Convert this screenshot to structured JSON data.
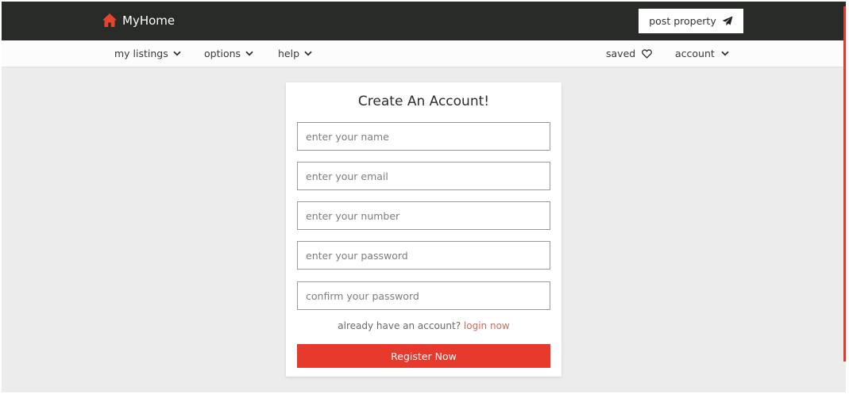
{
  "header": {
    "brand": "MyHome",
    "post_property_label": "post property"
  },
  "nav": {
    "left": [
      {
        "label": "my listings"
      },
      {
        "label": "options"
      },
      {
        "label": "help"
      }
    ],
    "saved_label": "saved",
    "account_label": "account"
  },
  "form": {
    "title": "Create An Account!",
    "name_placeholder": "enter your name",
    "email_placeholder": "enter your email",
    "number_placeholder": "enter your number",
    "password_placeholder": "enter your password",
    "confirm_placeholder": "confirm your password",
    "login_prompt": "already have an account?",
    "login_link": "login now",
    "register_label": "Register Now"
  },
  "colors": {
    "accent": "#e63a2c",
    "header_bg": "#292b28",
    "page_bg": "#ebeceb",
    "link": "#d2695d"
  },
  "icons": {
    "brand": "home-icon",
    "post": "paper-plane-icon",
    "saved": "heart-icon",
    "dropdown": "chevron-down-icon"
  }
}
